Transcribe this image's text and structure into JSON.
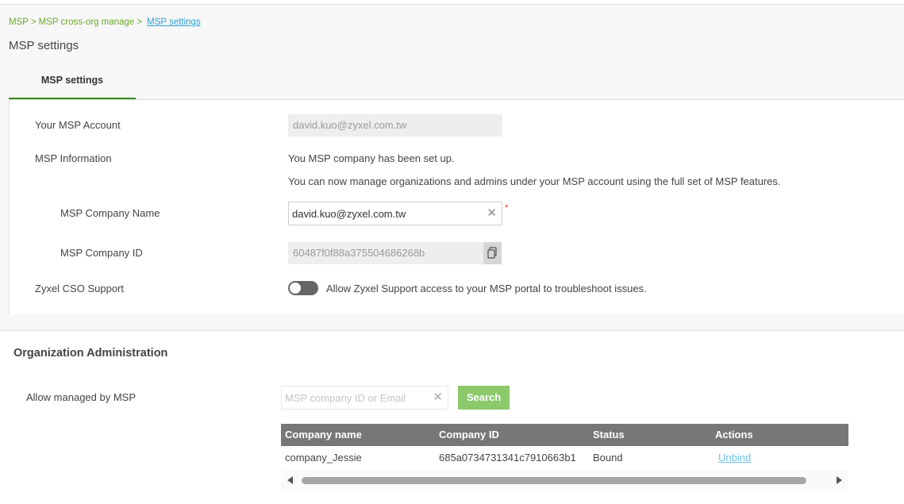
{
  "breadcrumb": {
    "items": [
      "MSP",
      "MSP cross-org manage"
    ],
    "separator": ">",
    "current": "MSP settings"
  },
  "page": {
    "title": "MSP settings"
  },
  "tabs": [
    {
      "label": "MSP settings",
      "active": true
    }
  ],
  "settings": {
    "msp_account": {
      "label": "Your MSP Account",
      "value": "david.kuo@zyxel.com.tw"
    },
    "msp_information": {
      "label": "MSP Information",
      "line1": "You MSP company has been set up.",
      "line2": "You can now manage organizations and admins under your MSP account using the full set of MSP features."
    },
    "company_name": {
      "label": "MSP Company Name",
      "value": "david.kuo@zyxel.com.tw",
      "required_mark": "*"
    },
    "company_id": {
      "label": "MSP Company ID",
      "value": "60487f0f88a375504686268b"
    },
    "cso_support": {
      "label": "Zyxel CSO Support",
      "toggle_on": false,
      "description": "Allow Zyxel Support access to your MSP portal to troubleshoot issues."
    }
  },
  "org_admin": {
    "title": "Organization Administration",
    "allow_label": "Allow managed by MSP",
    "search": {
      "placeholder": "MSP company ID or Email",
      "value": "",
      "button_label": "Search"
    },
    "table": {
      "columns": [
        "Company name",
        "Company ID",
        "Status",
        "Actions"
      ],
      "rows": [
        {
          "company_name": "company_Jessie",
          "company_id": "685a0734731341c7910663b1",
          "status": "Bound",
          "action": "Unbind"
        }
      ]
    }
  },
  "colors": {
    "accent_green": "#6aaa2a",
    "tab_underline": "#3a8a1a",
    "link_blue": "#2aa3d6",
    "search_button": "#8cc96a",
    "table_header": "#777777",
    "required_red": "#e03a3a"
  },
  "icons": {
    "clear": "close-icon",
    "copy": "copy-icon",
    "scroll_left": "arrow-left-icon",
    "scroll_right": "arrow-right-icon"
  }
}
